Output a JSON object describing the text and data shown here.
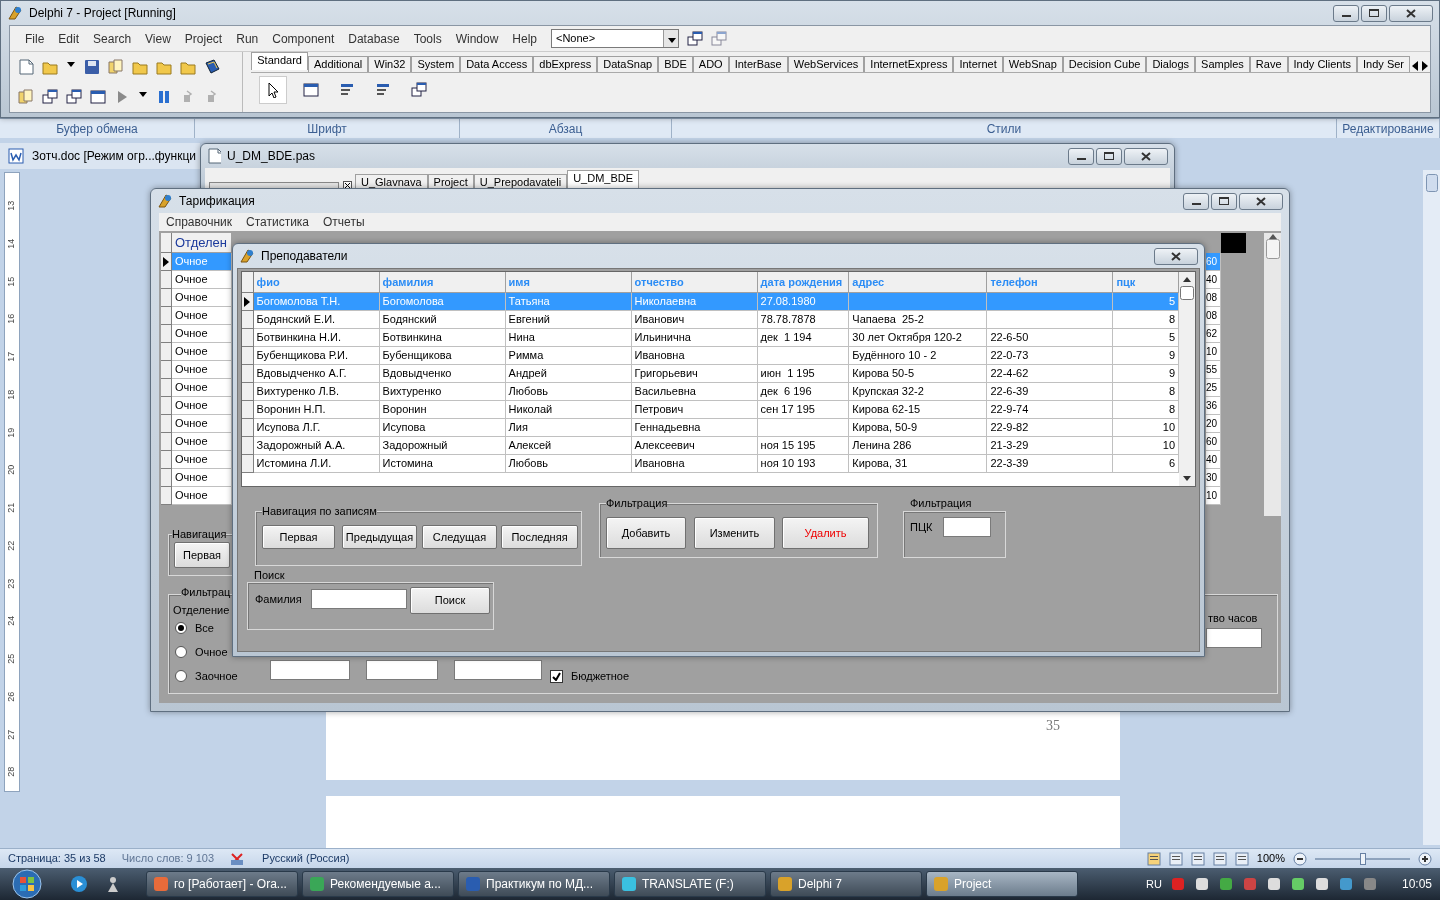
{
  "ide": {
    "title": "Delphi 7 - Project [Running]",
    "menu": [
      "File",
      "Edit",
      "Search",
      "View",
      "Project",
      "Run",
      "Component",
      "Database",
      "Tools",
      "Window",
      "Help"
    ],
    "unit_combo": "<None>",
    "palette_tabs": [
      {
        "label": "Standard",
        "selected": true
      },
      {
        "label": "Additional",
        "selected": false
      },
      {
        "label": "Win32",
        "selected": false
      },
      {
        "label": "System",
        "selected": false
      },
      {
        "label": "Data Access",
        "selected": false
      },
      {
        "label": "dbExpress",
        "selected": false
      },
      {
        "label": "DataSnap",
        "selected": false
      },
      {
        "label": "BDE",
        "selected": false
      },
      {
        "label": "ADO",
        "selected": false
      },
      {
        "label": "InterBase",
        "selected": false
      },
      {
        "label": "WebServices",
        "selected": false
      },
      {
        "label": "InternetExpress",
        "selected": false
      },
      {
        "label": "Internet",
        "selected": false
      },
      {
        "label": "WebSnap",
        "selected": false
      },
      {
        "label": "Decision Cube",
        "selected": false
      },
      {
        "label": "Dialogs",
        "selected": false
      },
      {
        "label": "Samples",
        "selected": false
      },
      {
        "label": "Rave",
        "selected": false
      },
      {
        "label": "Indy Clients",
        "selected": false
      },
      {
        "label": "Indy Ser",
        "selected": false
      }
    ]
  },
  "word": {
    "ribbon_groups": [
      "Буфер обмена",
      "Шрифт",
      "Абзац",
      "Стили",
      "Редактирование"
    ],
    "doc_title": "Зотч.doc [Режим огр...функци",
    "ruler_marks": [
      "13",
      "14",
      "15",
      "16",
      "17",
      "18",
      "19",
      "20",
      "21",
      "22",
      "23",
      "24",
      "25",
      "26",
      "27",
      "28"
    ],
    "page_number": "35",
    "status": {
      "page": "Страница: 35 из 58",
      "words": "Число слов: 9 103",
      "language": "Русский (Россия)",
      "zoom": "100%",
      "zoom_slider": {
        "level": 0.5
      }
    }
  },
  "editor": {
    "title": "U_DM_BDE.pas",
    "tabs": [
      {
        "label": "U_Glavnava",
        "selected": false
      },
      {
        "label": "Project",
        "selected": false
      },
      {
        "label": "U_Prepodavateli",
        "selected": false
      },
      {
        "label": "U_DM_BDE",
        "selected": true
      }
    ]
  },
  "tarif": {
    "title": "Тарификация",
    "menu": [
      "Справочник",
      "Статистика",
      "Отчеты"
    ],
    "grid_column_1": "Отделен",
    "rows": [
      {
        "column_1": "Очное",
        "column_2": "60",
        "selected": true
      },
      {
        "column_1": "Очное",
        "column_2": "40",
        "selected": false
      },
      {
        "column_1": "Очное",
        "column_2": "08",
        "selected": false
      },
      {
        "column_1": "Очное",
        "column_2": "08",
        "selected": false
      },
      {
        "column_1": "Очное",
        "column_2": "62",
        "selected": false
      },
      {
        "column_1": "Очное",
        "column_2": "10",
        "selected": false
      },
      {
        "column_1": "Очное",
        "column_2": "55",
        "selected": false
      },
      {
        "column_1": "Очное",
        "column_2": "25",
        "selected": false
      },
      {
        "column_1": "Очное",
        "column_2": "36",
        "selected": false
      },
      {
        "column_1": "Очное",
        "column_2": "20",
        "selected": false
      },
      {
        "column_1": "Очное",
        "column_2": "60",
        "selected": false
      },
      {
        "column_1": "Очное",
        "column_2": "40",
        "selected": false
      },
      {
        "column_1": "Очное",
        "column_2": "30",
        "selected": false
      },
      {
        "column_1": "Очное",
        "column_2": "10",
        "selected": false
      }
    ],
    "nav_group": "Навигация",
    "first_button": "Первая",
    "filter_group": "Фильтрац",
    "dept_label": "Отделение",
    "radios": [
      {
        "label": "Все",
        "selected": true
      },
      {
        "label": "Очное",
        "selected": false
      },
      {
        "label": "Заочное",
        "selected": false
      }
    ],
    "budget": {
      "label": "Бюджетное",
      "checked": true
    },
    "hours_label": "тво часов"
  },
  "teachers": {
    "title": "Преподаватели",
    "columns": [
      "фио",
      "фамилия",
      "имя",
      "отчество",
      "дата рождения",
      "адрес",
      "телефон",
      "пцк"
    ],
    "rows": [
      {
        "selected": true,
        "cells": [
          "Богомолова Т.Н.",
          "Богомолова",
          "Татьяна",
          "Николаевна",
          "27.08.1980",
          null,
          null,
          "5"
        ]
      },
      {
        "selected": false,
        "cells": [
          "Бодянский Е.И.",
          "Бодянский",
          "Евгений",
          "Иванович",
          "78.78.7878",
          "Чапаева  25-2",
          null,
          "8"
        ]
      },
      {
        "selected": false,
        "cells": [
          "Ботвинкина Н.И.",
          "Ботвинкина",
          "Нина",
          "Ильинична",
          "дек  1 194",
          "30 лет Октября 120-2",
          "22-6-50",
          "5"
        ]
      },
      {
        "selected": false,
        "cells": [
          "Бубенщикова Р.И.",
          "Бубенщикова",
          "Римма",
          "Ивановна",
          null,
          "Будённого 10 - 2",
          "22-0-73",
          "9"
        ]
      },
      {
        "selected": false,
        "cells": [
          "Вдовыдченко А.Г.",
          "Вдовыдченко",
          "Андрей",
          "Григорьевич",
          "июн  1 195",
          "Кирова 50-5",
          "22-4-62",
          "9"
        ]
      },
      {
        "selected": false,
        "cells": [
          "Вихтуренко Л.В.",
          "Вихтуренко",
          "Любовь",
          "Васильевна",
          "дек  6 196",
          "Крупская 32-2",
          "22-6-39",
          "8"
        ]
      },
      {
        "selected": false,
        "cells": [
          "Воронин Н.П.",
          "Воронин",
          "Николай",
          "Петрович",
          "сен 17 195",
          "Кирова 62-15",
          "22-9-74",
          "8"
        ]
      },
      {
        "selected": false,
        "cells": [
          "Исупова Л.Г.",
          "Исупова",
          "Лия",
          "Геннадьевна",
          null,
          "Кирова, 50-9",
          "22-9-82",
          "10"
        ]
      },
      {
        "selected": false,
        "cells": [
          "Задорожный А.А.",
          "Задорожный",
          "Алексей",
          "Алексеевич",
          "ноя 15 195",
          "Ленина 286",
          "21-3-29",
          "10"
        ]
      },
      {
        "selected": false,
        "cells": [
          "Истомина Л.И.",
          "Истомина",
          "Любовь",
          "Ивановна",
          "ноя 10 193",
          "Кирова, 31",
          "22-3-39",
          "6"
        ]
      }
    ],
    "nav": {
      "title": "Навигация по записям",
      "buttons": [
        "Первая",
        "Предыдущая",
        "Следущая",
        "Последняя"
      ]
    },
    "edit": {
      "title": "Фильтрация",
      "buttons": [
        {
          "label": "Добавить",
          "kind": "normal"
        },
        {
          "label": "Изменить",
          "kind": "normal"
        },
        {
          "label": "Удалить",
          "kind": "danger"
        }
      ]
    },
    "pck_filter": {
      "title": "Фильтрация",
      "label": "ПЦК"
    },
    "search": {
      "title": "Поиск",
      "label": "Фамилия",
      "button": "Поиск"
    }
  },
  "taskbar": {
    "items": [
      {
        "label": "го [Работает] - Ora...",
        "selected": false
      },
      {
        "label": "Рекомендуемые а...",
        "selected": false
      },
      {
        "label": "Практикум по МД...",
        "selected": false
      },
      {
        "label": "TRANSLATE (F:)",
        "selected": false
      },
      {
        "label": "Delphi 7",
        "selected": false
      },
      {
        "label": "Project",
        "selected": true
      }
    ],
    "language": "RU",
    "time": "10:05"
  }
}
